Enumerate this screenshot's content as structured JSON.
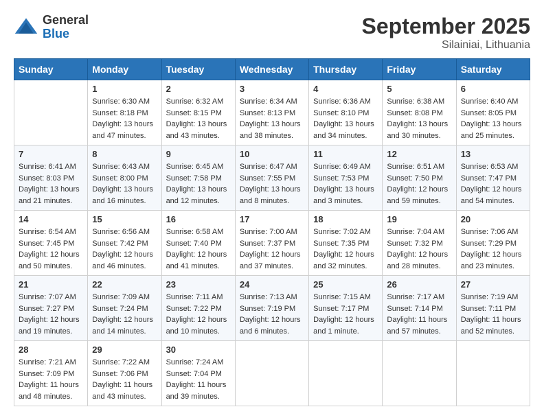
{
  "logo": {
    "general": "General",
    "blue": "Blue"
  },
  "header": {
    "month": "September 2025",
    "location": "Silainiai, Lithuania"
  },
  "days_of_week": [
    "Sunday",
    "Monday",
    "Tuesday",
    "Wednesday",
    "Thursday",
    "Friday",
    "Saturday"
  ],
  "weeks": [
    [
      {
        "day": null
      },
      {
        "day": 1,
        "sunrise": "6:30 AM",
        "sunset": "8:18 PM",
        "daylight": "13 hours and 47 minutes."
      },
      {
        "day": 2,
        "sunrise": "6:32 AM",
        "sunset": "8:15 PM",
        "daylight": "13 hours and 43 minutes."
      },
      {
        "day": 3,
        "sunrise": "6:34 AM",
        "sunset": "8:13 PM",
        "daylight": "13 hours and 38 minutes."
      },
      {
        "day": 4,
        "sunrise": "6:36 AM",
        "sunset": "8:10 PM",
        "daylight": "13 hours and 34 minutes."
      },
      {
        "day": 5,
        "sunrise": "6:38 AM",
        "sunset": "8:08 PM",
        "daylight": "13 hours and 30 minutes."
      },
      {
        "day": 6,
        "sunrise": "6:40 AM",
        "sunset": "8:05 PM",
        "daylight": "13 hours and 25 minutes."
      }
    ],
    [
      {
        "day": 7,
        "sunrise": "6:41 AM",
        "sunset": "8:03 PM",
        "daylight": "13 hours and 21 minutes."
      },
      {
        "day": 8,
        "sunrise": "6:43 AM",
        "sunset": "8:00 PM",
        "daylight": "13 hours and 16 minutes."
      },
      {
        "day": 9,
        "sunrise": "6:45 AM",
        "sunset": "7:58 PM",
        "daylight": "13 hours and 12 minutes."
      },
      {
        "day": 10,
        "sunrise": "6:47 AM",
        "sunset": "7:55 PM",
        "daylight": "13 hours and 8 minutes."
      },
      {
        "day": 11,
        "sunrise": "6:49 AM",
        "sunset": "7:53 PM",
        "daylight": "13 hours and 3 minutes."
      },
      {
        "day": 12,
        "sunrise": "6:51 AM",
        "sunset": "7:50 PM",
        "daylight": "12 hours and 59 minutes."
      },
      {
        "day": 13,
        "sunrise": "6:53 AM",
        "sunset": "7:47 PM",
        "daylight": "12 hours and 54 minutes."
      }
    ],
    [
      {
        "day": 14,
        "sunrise": "6:54 AM",
        "sunset": "7:45 PM",
        "daylight": "12 hours and 50 minutes."
      },
      {
        "day": 15,
        "sunrise": "6:56 AM",
        "sunset": "7:42 PM",
        "daylight": "12 hours and 46 minutes."
      },
      {
        "day": 16,
        "sunrise": "6:58 AM",
        "sunset": "7:40 PM",
        "daylight": "12 hours and 41 minutes."
      },
      {
        "day": 17,
        "sunrise": "7:00 AM",
        "sunset": "7:37 PM",
        "daylight": "12 hours and 37 minutes."
      },
      {
        "day": 18,
        "sunrise": "7:02 AM",
        "sunset": "7:35 PM",
        "daylight": "12 hours and 32 minutes."
      },
      {
        "day": 19,
        "sunrise": "7:04 AM",
        "sunset": "7:32 PM",
        "daylight": "12 hours and 28 minutes."
      },
      {
        "day": 20,
        "sunrise": "7:06 AM",
        "sunset": "7:29 PM",
        "daylight": "12 hours and 23 minutes."
      }
    ],
    [
      {
        "day": 21,
        "sunrise": "7:07 AM",
        "sunset": "7:27 PM",
        "daylight": "12 hours and 19 minutes."
      },
      {
        "day": 22,
        "sunrise": "7:09 AM",
        "sunset": "7:24 PM",
        "daylight": "12 hours and 14 minutes."
      },
      {
        "day": 23,
        "sunrise": "7:11 AM",
        "sunset": "7:22 PM",
        "daylight": "12 hours and 10 minutes."
      },
      {
        "day": 24,
        "sunrise": "7:13 AM",
        "sunset": "7:19 PM",
        "daylight": "12 hours and 6 minutes."
      },
      {
        "day": 25,
        "sunrise": "7:15 AM",
        "sunset": "7:17 PM",
        "daylight": "12 hours and 1 minute."
      },
      {
        "day": 26,
        "sunrise": "7:17 AM",
        "sunset": "7:14 PM",
        "daylight": "11 hours and 57 minutes."
      },
      {
        "day": 27,
        "sunrise": "7:19 AM",
        "sunset": "7:11 PM",
        "daylight": "11 hours and 52 minutes."
      }
    ],
    [
      {
        "day": 28,
        "sunrise": "7:21 AM",
        "sunset": "7:09 PM",
        "daylight": "11 hours and 48 minutes."
      },
      {
        "day": 29,
        "sunrise": "7:22 AM",
        "sunset": "7:06 PM",
        "daylight": "11 hours and 43 minutes."
      },
      {
        "day": 30,
        "sunrise": "7:24 AM",
        "sunset": "7:04 PM",
        "daylight": "11 hours and 39 minutes."
      },
      {
        "day": null
      },
      {
        "day": null
      },
      {
        "day": null
      },
      {
        "day": null
      }
    ]
  ],
  "labels": {
    "sunrise": "Sunrise:",
    "sunset": "Sunset:",
    "daylight": "Daylight:"
  }
}
